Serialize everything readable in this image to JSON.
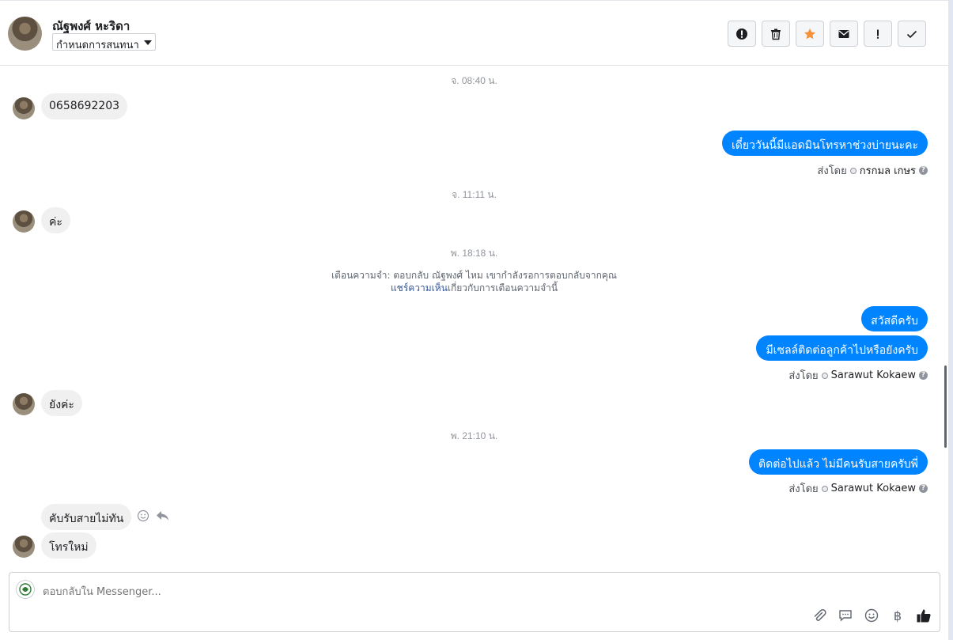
{
  "header": {
    "contact_name": "ณัฐพงศ์ หะริดา",
    "status_selected": "กำหนดการสนทนา"
  },
  "messages": {
    "timestamps": [
      "จ. 08:40 น.",
      "จ. 11:11 น.",
      "พ. 18:18 น.",
      "พ. 21:10 น."
    ],
    "incoming": [
      "0658692203",
      "ค่ะ",
      "ยังค่ะ",
      "คับรับสายไม่ทัน",
      "โทรใหม่"
    ],
    "outgoing": [
      "เดี๋ยววันนี้มีแอดมินโทรหาช่วงบ่ายนะคะ",
      "สวัสดีครับ",
      "มีเซลล์ติดต่อลูกค้าไปหรือยังครับ",
      "ติดต่อไปแล้ว ไม่มีคนรับสายครับพี่"
    ],
    "sent_by_label": "ส่งโดย",
    "senders": [
      "กรกมล เกษร",
      "Sarawut Kokaew",
      "Sarawut Kokaew"
    ],
    "reminder_line1": "เตือนความจำ: ตอบกลับ ณัฐพงศ์ ไหม เขากำลังรอการตอบกลับจากคุณ",
    "reminder_link": "แชร์ความเห็น",
    "reminder_line2_rest": "เกี่ยวกับการเตือนความจำนี้"
  },
  "composer": {
    "placeholder": "ตอบกลับใน Messenger..."
  },
  "colors": {
    "outgoing_bubble": "#0084ff",
    "incoming_bubble": "#f1f0f0",
    "star": "#f7923a"
  }
}
